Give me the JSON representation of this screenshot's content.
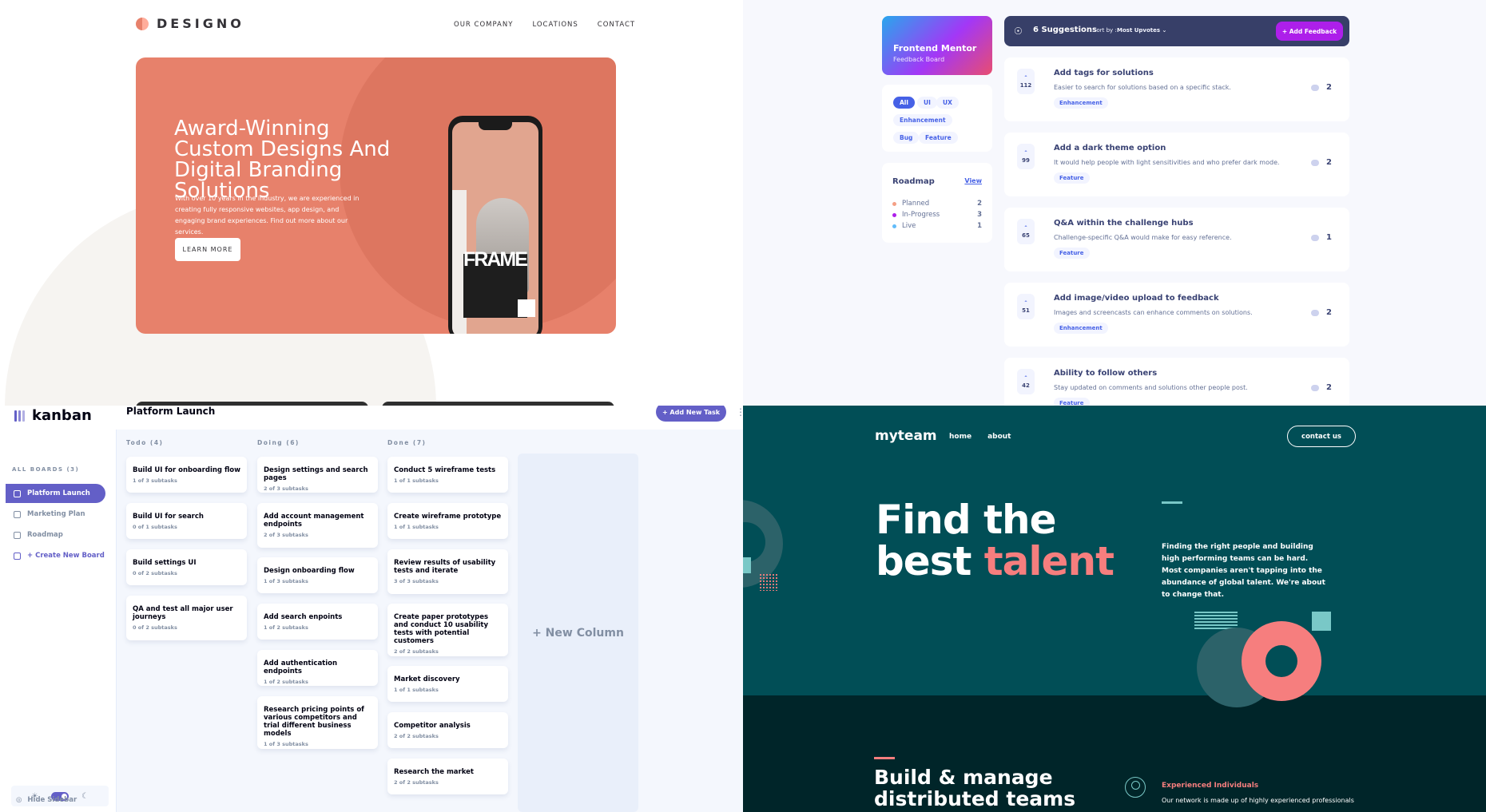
{
  "designo": {
    "logo": "DESIGNO",
    "nav": [
      "OUR COMPANY",
      "LOCATIONS",
      "CONTACT"
    ],
    "hero_title": "Award-Winning Custom Designs And Digital Branding Solutions",
    "hero_text": "With over 10 years in the industry, we are experienced in creating fully responsive websites, app design, and engaging brand experiences. Find out more about our services.",
    "cta": "LEARN MORE",
    "phone_word": "FRAME",
    "colors": {
      "peach": "#e7816b",
      "dark": "#333136"
    }
  },
  "feedback": {
    "brand_title": "Frontend Mentor",
    "brand_subtitle": "Feedback Board",
    "tags": [
      "All",
      "UI",
      "UX",
      "Enhancement",
      "Bug",
      "Feature"
    ],
    "active_tag": "All",
    "roadmap": {
      "title": "Roadmap",
      "view": "View",
      "items": [
        {
          "label": "Planned",
          "count": "2",
          "color": "#f49f85"
        },
        {
          "label": "In-Progress",
          "count": "3",
          "color": "#ad1fea"
        },
        {
          "label": "Live",
          "count": "1",
          "color": "#62bcfa"
        }
      ]
    },
    "toolbar": {
      "suggestions": "6 Suggestions",
      "sort_label": "Sort by :",
      "sort_value": "Most Upvotes",
      "add_button": "+ Add Feedback"
    },
    "suggestions": [
      {
        "votes": "112",
        "title": "Add tags for solutions",
        "desc": "Easier to search for solutions based on a specific stack.",
        "category": "Enhancement",
        "comments": "2"
      },
      {
        "votes": "99",
        "title": "Add a dark theme option",
        "desc": "It would help people with light sensitivities and who prefer dark mode.",
        "category": "Feature",
        "comments": "2"
      },
      {
        "votes": "65",
        "title": "Q&A within the challenge hubs",
        "desc": "Challenge-specific Q&A would make for easy reference.",
        "category": "Feature",
        "comments": "1"
      },
      {
        "votes": "51",
        "title": "Add image/video upload to feedback",
        "desc": "Images and screencasts can enhance comments on solutions.",
        "category": "Enhancement",
        "comments": "2"
      },
      {
        "votes": "42",
        "title": "Ability to follow others",
        "desc": "Stay updated on comments and solutions other people post.",
        "category": "Feature",
        "comments": "2"
      }
    ]
  },
  "kanban": {
    "logo": "kanban",
    "board_title": "Platform Launch",
    "add_task": "+ Add New Task",
    "all_boards": "ALL BOARDS (3)",
    "boards": [
      "Platform Launch",
      "Marketing Plan",
      "Roadmap"
    ],
    "create_board": "+ Create New Board",
    "hide_sidebar": "Hide Sidebar",
    "columns": [
      {
        "name": "Todo (4)",
        "tasks": [
          {
            "title": "Build UI for onboarding flow",
            "sub": "1 of 3 subtasks"
          },
          {
            "title": "Build UI for search",
            "sub": "0 of 1 subtasks"
          },
          {
            "title": "Build settings UI",
            "sub": "0 of 2 subtasks"
          },
          {
            "title": "QA and test all major user journeys",
            "sub": "0 of 2 subtasks"
          }
        ]
      },
      {
        "name": "Doing (6)",
        "tasks": [
          {
            "title": "Design settings and search pages",
            "sub": "2 of 3 subtasks"
          },
          {
            "title": "Add account management endpoints",
            "sub": "2 of 3 subtasks"
          },
          {
            "title": "Design onboarding flow",
            "sub": "1 of 3 subtasks"
          },
          {
            "title": "Add search enpoints",
            "sub": "1 of 2 subtasks"
          },
          {
            "title": "Add authentication endpoints",
            "sub": "1 of 2 subtasks"
          },
          {
            "title": "Research pricing points of various competitors and trial different business models",
            "sub": "1 of 3 subtasks"
          }
        ]
      },
      {
        "name": "Done (7)",
        "tasks": [
          {
            "title": "Conduct 5 wireframe tests",
            "sub": "1 of 1 subtasks"
          },
          {
            "title": "Create wireframe prototype",
            "sub": "1 of 1 subtasks"
          },
          {
            "title": "Review results of usability tests and iterate",
            "sub": "3 of 3 subtasks"
          },
          {
            "title": "Create paper prototypes and conduct 10 usability tests with potential customers",
            "sub": "2 of 2 subtasks"
          },
          {
            "title": "Market discovery",
            "sub": "1 of 1 subtasks"
          },
          {
            "title": "Competitor analysis",
            "sub": "2 of 2 subtasks"
          },
          {
            "title": "Research the market",
            "sub": "2 of 2 subtasks"
          }
        ]
      }
    ],
    "new_column": "+ New Column"
  },
  "myteam": {
    "logo": "myteam",
    "nav": [
      "home",
      "about"
    ],
    "contact": "contact us",
    "headline_1": "Find the",
    "headline_2_pre": "best ",
    "headline_2_accent": "talent",
    "lead": "Finding the right people and building high performing teams can be hard. Most companies aren't tapping into the abundance of global talent. We're about to change that.",
    "section_title": "Build & manage distributed teams",
    "feature_title": "Experienced Individuals",
    "feature_text": "Our network is made up of highly experienced professionals",
    "colors": {
      "bg": "#014e56",
      "accent": "#f67e7e",
      "teal": "#79c8c7"
    }
  }
}
